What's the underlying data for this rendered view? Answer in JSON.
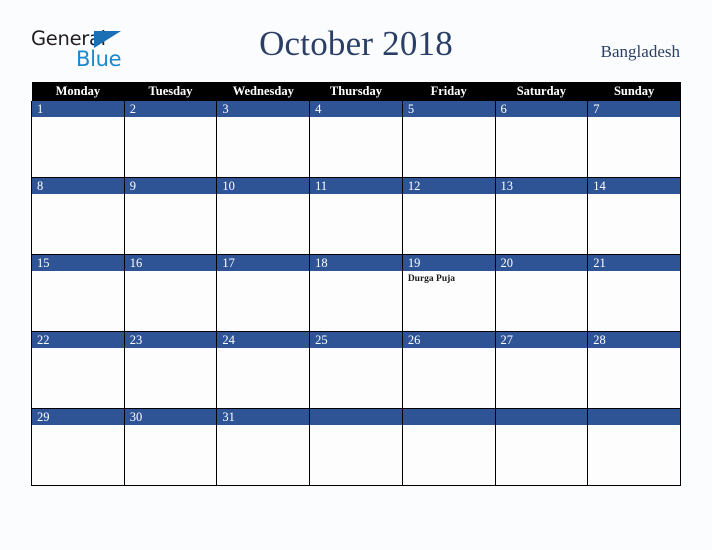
{
  "brand": {
    "word_one": "General",
    "word_two": "Blue",
    "triangle_icon": "triangle-icon",
    "accent_blue": "#1a8ad0",
    "triangle_blue": "#1a6fb5",
    "word_one_color": "#231f20"
  },
  "header": {
    "title": "October 2018",
    "country": "Bangladesh",
    "title_color": "#2b3f66"
  },
  "calendar": {
    "weekday_headers": [
      "Monday",
      "Tuesday",
      "Wednesday",
      "Thursday",
      "Friday",
      "Saturday",
      "Sunday"
    ],
    "header_bg": "#000000",
    "header_text_color": "#ffffff",
    "day_bar_bg": "#2e5496",
    "day_bar_text_color": "#ffffff",
    "grid_line_color": "#000000",
    "cell_bg": "#fdfdfd",
    "weeks": [
      [
        {
          "date": "1",
          "events": []
        },
        {
          "date": "2",
          "events": []
        },
        {
          "date": "3",
          "events": []
        },
        {
          "date": "4",
          "events": []
        },
        {
          "date": "5",
          "events": []
        },
        {
          "date": "6",
          "events": []
        },
        {
          "date": "7",
          "events": []
        }
      ],
      [
        {
          "date": "8",
          "events": []
        },
        {
          "date": "9",
          "events": []
        },
        {
          "date": "10",
          "events": []
        },
        {
          "date": "11",
          "events": []
        },
        {
          "date": "12",
          "events": []
        },
        {
          "date": "13",
          "events": []
        },
        {
          "date": "14",
          "events": []
        }
      ],
      [
        {
          "date": "15",
          "events": []
        },
        {
          "date": "16",
          "events": []
        },
        {
          "date": "17",
          "events": []
        },
        {
          "date": "18",
          "events": []
        },
        {
          "date": "19",
          "events": [
            "Durga Puja"
          ]
        },
        {
          "date": "20",
          "events": []
        },
        {
          "date": "21",
          "events": []
        }
      ],
      [
        {
          "date": "22",
          "events": []
        },
        {
          "date": "23",
          "events": []
        },
        {
          "date": "24",
          "events": []
        },
        {
          "date": "25",
          "events": []
        },
        {
          "date": "26",
          "events": []
        },
        {
          "date": "27",
          "events": []
        },
        {
          "date": "28",
          "events": []
        }
      ],
      [
        {
          "date": "29",
          "events": []
        },
        {
          "date": "30",
          "events": []
        },
        {
          "date": "31",
          "events": []
        },
        {
          "date": "",
          "events": []
        },
        {
          "date": "",
          "events": []
        },
        {
          "date": "",
          "events": []
        },
        {
          "date": "",
          "events": []
        }
      ]
    ]
  }
}
